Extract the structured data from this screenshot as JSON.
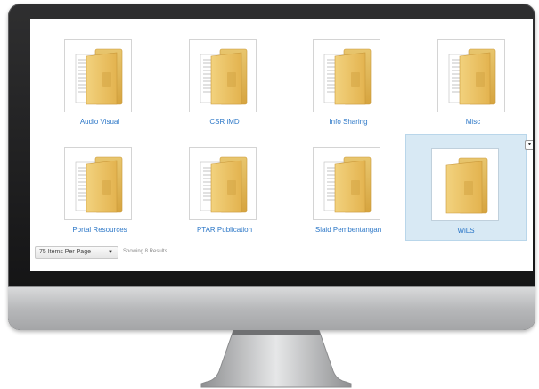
{
  "folders": [
    {
      "label": "Audio Visual"
    },
    {
      "label": "CSR iMD"
    },
    {
      "label": "Info Sharing"
    },
    {
      "label": "Misc"
    },
    {
      "label": "Portal Resources"
    },
    {
      "label": "PTAR Publication"
    },
    {
      "label": "Slaid Pembentangan"
    },
    {
      "label": "WiLS"
    }
  ],
  "selected_folder": "WiLS",
  "tile_menu_glyph": "▾",
  "footer": {
    "per_page_label": "75 Items Per Page",
    "per_page_caret": "▼",
    "results_text": "Showing 8 Results"
  },
  "colors": {
    "link_blue": "#2f79c8",
    "selected_bg": "#d8e9f4",
    "folder_yellow": "#e9b94f"
  }
}
